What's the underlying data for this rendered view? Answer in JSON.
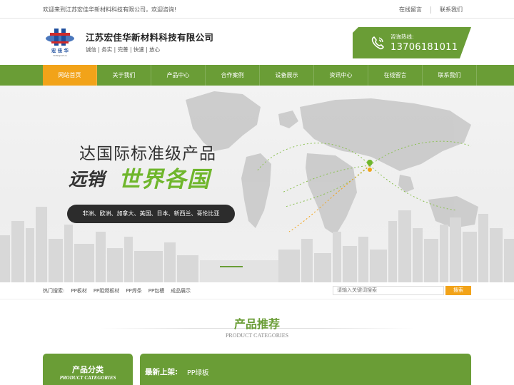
{
  "topbar": {
    "welcome": "欢迎来到江苏宏佳华新材料科技有限公司，欢迎咨询!",
    "links": [
      "在线留言",
      "联系我们"
    ]
  },
  "header": {
    "logo_text": "宏 佳 华",
    "logo_sub": "HONGJIAHUA",
    "company_name": "江苏宏佳华新材料科技有限公司",
    "slogan": "诚信 | 务实 | 完善 | 快速 | 放心",
    "hotline_label": "咨询热线:",
    "hotline_number": "13706181011",
    "accent_color": "#6a9d36"
  },
  "nav": {
    "items": [
      "网站首页",
      "关于我们",
      "产品中心",
      "合作案例",
      "设备展示",
      "资讯中心",
      "在线留言",
      "联系我们"
    ],
    "active_index": 0,
    "active_color": "#f2a319"
  },
  "banner": {
    "line1": "达国际标准级产品",
    "line2a": "远销",
    "line2b": "世界各国",
    "pill": "非洲、欧洲、加拿大、美国、日本、新西兰、哥伦比亚"
  },
  "search": {
    "hot_label": "热门搜索:",
    "hot_terms": [
      "PP板材",
      "PP阻燃板材",
      "PP焊条",
      "PP包槽",
      "成品展示"
    ],
    "placeholder": "请输入关键词搜索",
    "button": "搜索"
  },
  "section": {
    "title": "产品推荐",
    "subtitle": "PRODUCT CATEGORIES"
  },
  "category": {
    "title": "产品分类",
    "subtitle": "PRODUCT CATEGORIES"
  },
  "newest": {
    "label": "最新上架:",
    "value": "PP绿板"
  }
}
